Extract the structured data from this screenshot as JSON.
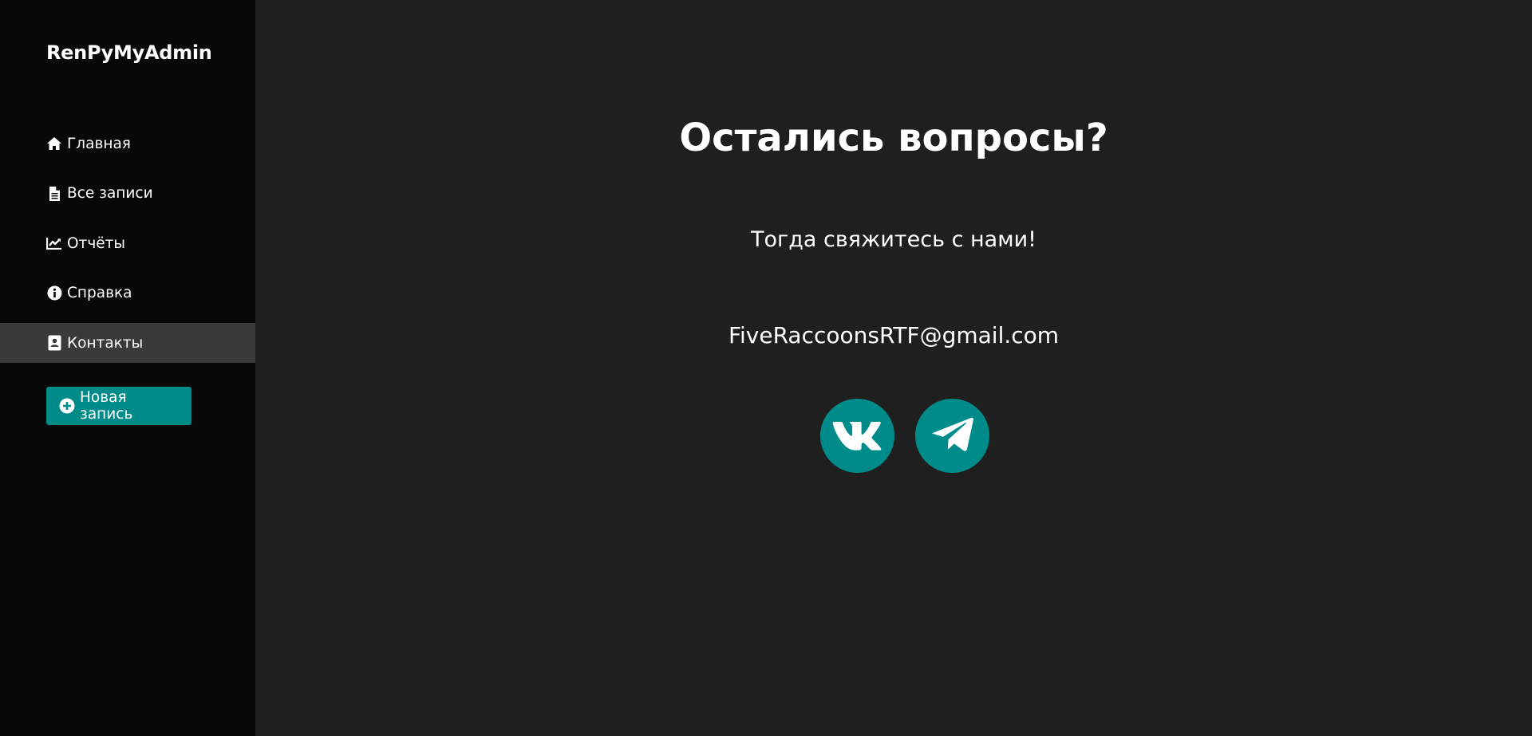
{
  "sidebar": {
    "brand": "RenPyMyAdmin",
    "items": [
      {
        "label": "Главная",
        "icon": "home-icon"
      },
      {
        "label": "Все записи",
        "icon": "file-icon"
      },
      {
        "label": "Отчёты",
        "icon": "chart-line-icon"
      },
      {
        "label": "Справка",
        "icon": "info-circle-icon"
      },
      {
        "label": "Контакты",
        "icon": "address-card-icon",
        "active": true
      }
    ],
    "new_button": {
      "label": "Новая запись",
      "icon": "plus-circle-icon"
    }
  },
  "main": {
    "title": "Остались вопросы?",
    "subtitle": "Тогда свяжитесь с нами!",
    "email": "FiveRaccoonsRTF@gmail.com",
    "socials": [
      {
        "icon": "vk-icon"
      },
      {
        "icon": "telegram-icon"
      }
    ]
  },
  "colors": {
    "accent": "#008b8b",
    "sidebar_bg": "#080808",
    "main_bg": "#1f1f1f",
    "active_item_bg": "#3a3a3a",
    "text": "#ffffff"
  }
}
